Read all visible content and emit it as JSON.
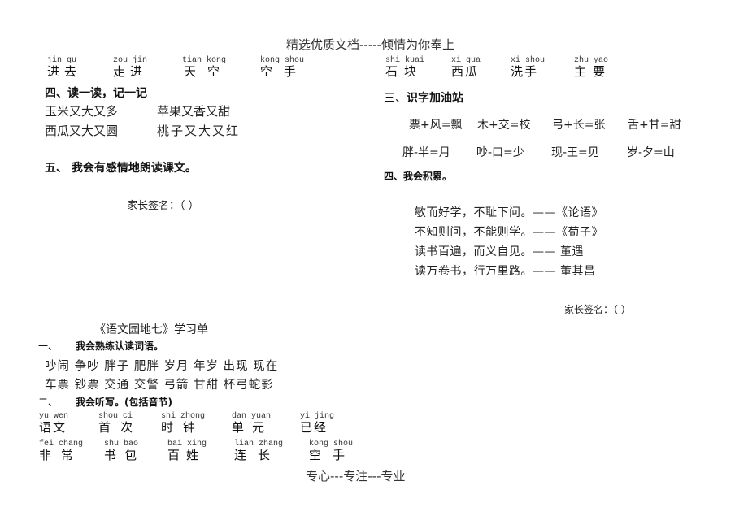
{
  "header": {
    "title": "精选优质文档-----倾情为你奉上"
  },
  "footer": {
    "text": "专心---专注---专业"
  },
  "left_top": {
    "pinyin_row": [
      {
        "pinyin": "jin qu",
        "hanzi": "进去"
      },
      {
        "pinyin": "zou jin",
        "hanzi": "走进"
      },
      {
        "pinyin": "tian kong",
        "hanzi": "天空"
      },
      {
        "pinyin": "kong shou",
        "hanzi": "空手"
      }
    ],
    "section4": {
      "title": "四、读一读，记一记",
      "lines": [
        [
          "玉米又大又多",
          "苹果又香又甜"
        ],
        [
          "西瓜又大又圆",
          "桃子又大又红"
        ]
      ]
    },
    "section5": {
      "title": "五、 我会有感情地朗读课文。"
    },
    "signature": "家长签名：（             ）"
  },
  "right_top": {
    "pinyin_row": [
      {
        "pinyin": "shi kuai",
        "hanzi": "石块"
      },
      {
        "pinyin": "xi gua",
        "hanzi": "西瓜"
      },
      {
        "pinyin": "xi shou",
        "hanzi": "洗手"
      },
      {
        "pinyin": "zhu yao",
        "hanzi": "主要"
      }
    ],
    "section3": {
      "num": "三、",
      "title": "识字加油站",
      "row1": [
        "票+风=飘",
        "木+交=校",
        "弓+长=张",
        "舌+甘=甜"
      ],
      "row2": [
        "胖-半=月",
        "吵-口=少",
        "现-王=见",
        "岁-夕=山"
      ]
    },
    "section4": {
      "title": "四、我会积累。",
      "quotes": [
        "敏而好学，不耻下问。——《论语》",
        "不知则问，不能则学。——《荀子》",
        "读书百遍，而义自见。—— 董遇",
        "读万卷书，行万里路。—— 董其昌"
      ]
    },
    "signature": "家长签名：（          ）"
  },
  "worksheet": {
    "title": "《语文园地七》学习单",
    "section1": {
      "num": "一、",
      "title": "我会熟练认读词语。",
      "row1": [
        "吵闹",
        "争吵",
        "胖子",
        "肥胖",
        "岁月",
        "年岁",
        "出现",
        "现在"
      ],
      "row2": [
        "车票",
        "钞票",
        "交通",
        "交警",
        "弓箭",
        "甘甜",
        "杯弓蛇影"
      ]
    },
    "section2": {
      "num": "二、",
      "title": "我会听写。(包括音节)",
      "row1": [
        {
          "pinyin": "yu wen",
          "hanzi": "语文"
        },
        {
          "pinyin": "shou ci",
          "hanzi": "首次"
        },
        {
          "pinyin": "shi zhong",
          "hanzi": "时钟"
        },
        {
          "pinyin": "dan yuan",
          "hanzi": "单元"
        },
        {
          "pinyin": "yi jing",
          "hanzi": "已经"
        }
      ],
      "row2": [
        {
          "pinyin": "fei chang",
          "hanzi": "非常"
        },
        {
          "pinyin": "shu bao",
          "hanzi": "书包"
        },
        {
          "pinyin": "bai xing",
          "hanzi": "百姓"
        },
        {
          "pinyin": "lian zhang",
          "hanzi": "连长"
        },
        {
          "pinyin": "kong shou",
          "hanzi": "空手"
        }
      ]
    }
  }
}
